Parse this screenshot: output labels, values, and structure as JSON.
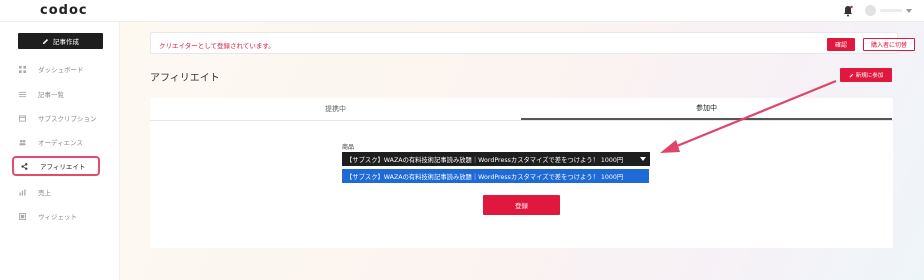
{
  "app": {
    "logo": "codoc"
  },
  "sidebar": {
    "create_label": "記事作成",
    "items": [
      {
        "label": "ダッシュボード",
        "icon": "grid-icon"
      },
      {
        "label": "記事一覧",
        "icon": "list-icon"
      },
      {
        "label": "サブスクリプション",
        "icon": "subscription-icon"
      },
      {
        "label": "オーディエンス",
        "icon": "people-icon"
      },
      {
        "label": "アフィリエイト",
        "icon": "share-icon",
        "active": true
      },
      {
        "label": "売上",
        "icon": "chart-icon"
      },
      {
        "label": "ウィジェット",
        "icon": "widget-icon"
      }
    ]
  },
  "notice": {
    "text": "クリエイターとして登録されています。",
    "confirm_label": "確認",
    "switch_label": "購入者に切替"
  },
  "page": {
    "title": "アフィリエイト",
    "new_label": "新規に参加"
  },
  "tabs": [
    {
      "label": "提携中",
      "active": false
    },
    {
      "label": "参加中",
      "active": true
    }
  ],
  "form": {
    "field_label": "商品",
    "selected_value": "【サブスク】WAZAの有料技術記事読み放題｜WordPressカスタマイズで差をつけよう！ 1000円",
    "option_label": "【サブスク】WAZAの有料技術記事読み放題｜WordPressカスタマイズで差をつけよう！ 1000円",
    "submit_label": "登録"
  },
  "colors": {
    "accent": "#e0183d",
    "highlight": "#e54b6a",
    "select_bg": "#1e1e1e",
    "option_highlight": "#1e6ad6"
  }
}
